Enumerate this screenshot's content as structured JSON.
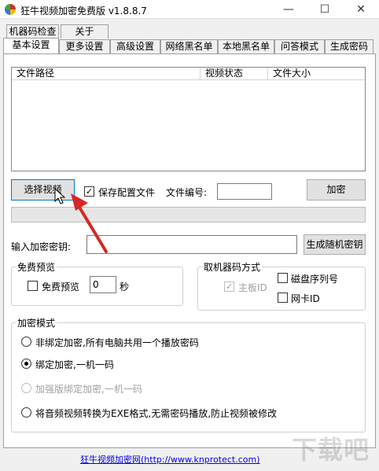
{
  "window": {
    "title": "狂牛视频加密免费版 v1.8.8.7",
    "minimize": "—",
    "maximize": "☐",
    "close": "✕"
  },
  "tabs_row1": [
    "机器码检查",
    "关于"
  ],
  "tabs_row2": [
    "基本设置",
    "更多设置",
    "高级设置",
    "网络黑名单",
    "本地黑名单",
    "问答模式",
    "生成密码"
  ],
  "file_list": {
    "columns": [
      "文件路径",
      "视频状态",
      "文件大小"
    ],
    "rows": []
  },
  "toolbar": {
    "select_video": "选择视频",
    "save_config_label": "保存配置文件",
    "save_config_checked": true,
    "file_number_label": "文件编号:",
    "file_number_value": "",
    "encrypt": "加密"
  },
  "progress": {
    "value": 0
  },
  "key": {
    "label": "输入加密密钥:",
    "value": "",
    "generate": "生成随机密钥"
  },
  "free_preview": {
    "title": "免费预览",
    "checkbox_label": "免费预览",
    "checked": false,
    "seconds_value": "0",
    "unit": "秒"
  },
  "machine_code": {
    "title": "取机器码方式",
    "mainboard": "主板ID",
    "mainboard_checked": true,
    "disk_serial": "磁盘序列号",
    "disk_checked": false,
    "nic": "网卡ID",
    "nic_checked": false
  },
  "encrypt_mode": {
    "title": "加密模式",
    "options": [
      {
        "label": "非绑定加密,所有电脑共用一个播放密码",
        "checked": false,
        "disabled": false
      },
      {
        "label": "绑定加密,一机一码",
        "checked": true,
        "disabled": false
      },
      {
        "label": "加强版绑定加密,一机一码",
        "checked": false,
        "disabled": true
      },
      {
        "label": "将音频视频转换为EXE格式,无需密码播放,防止视频被修改",
        "checked": false,
        "disabled": false
      }
    ]
  },
  "footer": {
    "link": "狂牛视频加密网(http://www.knprotect.com)"
  },
  "watermark": {
    "text": "下载吧"
  },
  "colors": {
    "arrow": "#d62828",
    "accent": "#0078d7"
  }
}
